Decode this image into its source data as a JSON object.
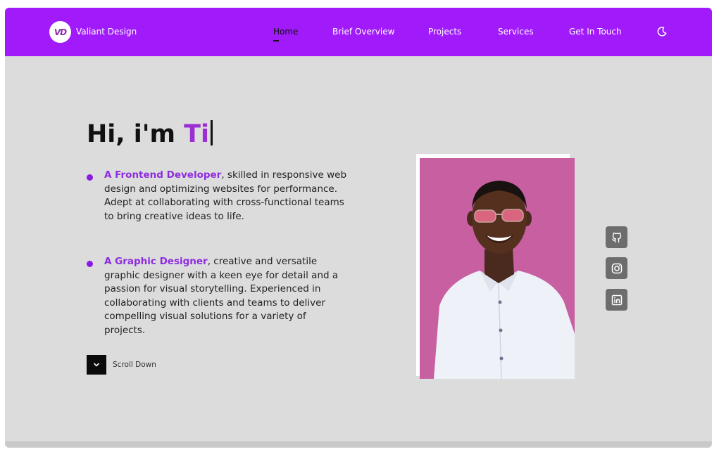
{
  "brand": {
    "logo_text": "VD",
    "name": "Valiant Design"
  },
  "nav": {
    "home": "Home",
    "overview": "Brief Overview",
    "projects": "Projects",
    "services": "Services",
    "contact": "Get In Touch"
  },
  "hero": {
    "greeting": "Hi, i'm ",
    "typed_name": "Ti"
  },
  "roles": [
    {
      "title": "A Frontend Developer",
      "desc": ", skilled in responsive web design and optimizing websites for performance. Adept at collaborating with cross-functional teams to bring creative ideas to life."
    },
    {
      "title": "A Graphic Designer",
      "desc": ", creative and versatile graphic designer with a keen eye for detail and a passion for visual storytelling. Experienced in collaborating with clients and teams to deliver compelling visual solutions for a variety of projects."
    }
  ],
  "scroll": {
    "label": "Scroll Down"
  },
  "colors": {
    "nav_bg": "#a11bfa",
    "accent": "#9b2fd4",
    "page_bg": "#dcdcdc",
    "photo_bg": "#c75fa1"
  },
  "icons": [
    "moon-icon",
    "chevron-down-icon",
    "github-icon",
    "instagram-icon",
    "linkedin-icon"
  ]
}
